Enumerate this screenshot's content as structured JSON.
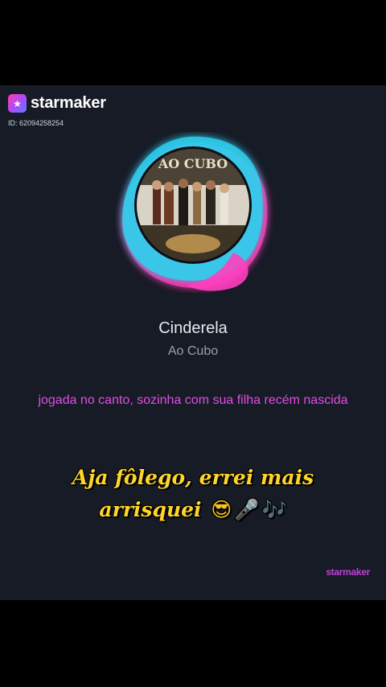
{
  "app": {
    "logo_text": "starmaker",
    "logo_badge_glyph": "★",
    "user_id": "ID: 62094258254",
    "watermark": "starmaker"
  },
  "player": {
    "song_title": "Cinderela",
    "artist": "Ao Cubo",
    "album_cover_text": "AO CUBO"
  },
  "lyrics": {
    "current_line": "jogada no canto, sozinha com sua filha recém nascida"
  },
  "caption": {
    "text": "Aja fôlego, errei mais arrisquei",
    "emojis": [
      "😎",
      "🎤",
      "🎶"
    ]
  },
  "colors": {
    "background": "#161b26",
    "lyric": "#e44ce6",
    "caption": "#ffd52a",
    "visualizer_cyan": "#29d3f0",
    "visualizer_pink": "#ff2fa6"
  }
}
